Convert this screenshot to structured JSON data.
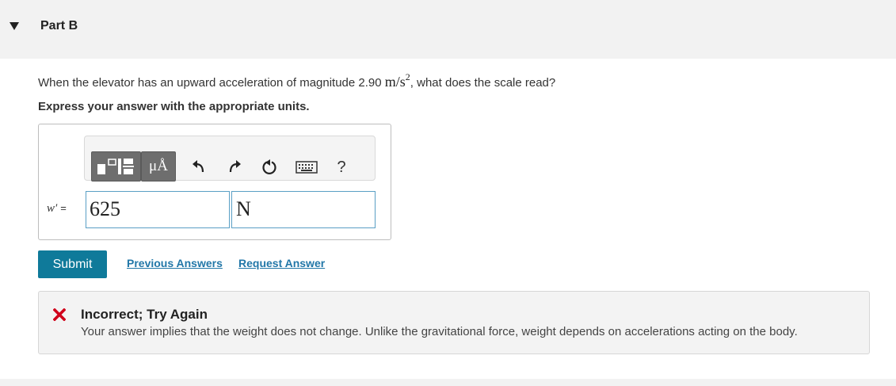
{
  "part": {
    "title": "Part B"
  },
  "question": {
    "prefix": "When the elevator has an upward acceleration of magnitude 2.90 ",
    "unit_base": "m/s",
    "unit_exp": "2",
    "suffix": ", what does the scale read?"
  },
  "instruction": "Express your answer with the appropriate units.",
  "toolbar": {
    "template_icon": "templates-icon",
    "units_label": "μÅ",
    "undo_icon": "undo-icon",
    "redo_icon": "redo-icon",
    "reset_icon": "reset-icon",
    "keyboard_icon": "keyboard-icon",
    "help_label": "?"
  },
  "answer": {
    "variable": "w′",
    "equals": "=",
    "value": "625",
    "units": "N"
  },
  "actions": {
    "submit_label": "Submit",
    "previous_answers_label": "Previous Answers",
    "request_answer_label": "Request Answer"
  },
  "feedback": {
    "icon": "incorrect-x-icon",
    "title": "Incorrect; Try Again",
    "message": "Your answer implies that the weight does not change. Unlike the gravitational force, weight depends on accelerations acting on the body."
  },
  "colors": {
    "submit_bg": "#0f7a9a",
    "link": "#2277a8",
    "incorrect": "#d0021b",
    "input_border": "#5a9fc5"
  }
}
